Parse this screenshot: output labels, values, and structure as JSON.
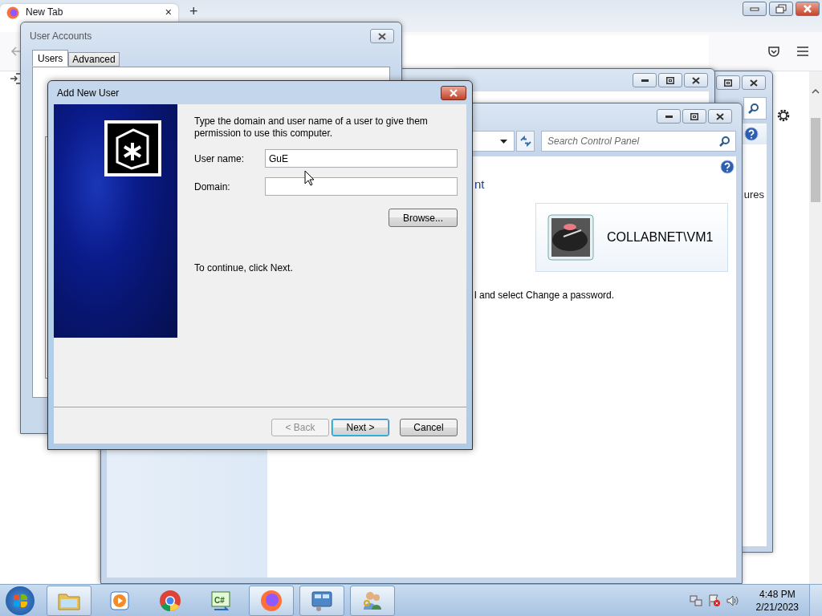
{
  "browser": {
    "tab": {
      "title": "New Tab",
      "close": "×"
    },
    "new_tab": "+"
  },
  "back_window": {
    "text": "ures"
  },
  "accounts_window": {
    "search": {
      "placeholder": "Search Control Panel"
    },
    "heading": "nt",
    "account_name": "COLLABNET\\VM1",
    "hint": "l and select Change a password."
  },
  "user_accounts": {
    "title": "User Accounts",
    "tabs": [
      {
        "label": "Users",
        "selected": true
      },
      {
        "label": "Advanced",
        "selected": false
      }
    ]
  },
  "add_user": {
    "title": "Add New User",
    "instructions": "Type the domain and user name of a user to give them permission to use this computer.",
    "fields": [
      {
        "label": "User name:",
        "value": "GuE"
      },
      {
        "label": "Domain:"
      }
    ],
    "browse": "Browse...",
    "continue_text": "To continue, click Next.",
    "buttons": [
      {
        "label": "< Back",
        "disabled": true,
        "default": false
      },
      {
        "label": "Next >",
        "disabled": false,
        "default": true
      },
      {
        "label": "Cancel",
        "disabled": false,
        "default": false
      }
    ]
  },
  "taskbar": {
    "items": [
      {
        "kind": "explorer",
        "running": true
      },
      {
        "kind": "media",
        "running": false
      },
      {
        "kind": "chrome",
        "running": false
      },
      {
        "kind": "csharp",
        "label": "C#",
        "running": false
      },
      {
        "kind": "firefox",
        "running": true
      },
      {
        "kind": "panel",
        "running": true
      },
      {
        "kind": "users",
        "running": true
      }
    ],
    "clock": {
      "time": "4:48 PM",
      "date": "2/21/2023"
    }
  }
}
